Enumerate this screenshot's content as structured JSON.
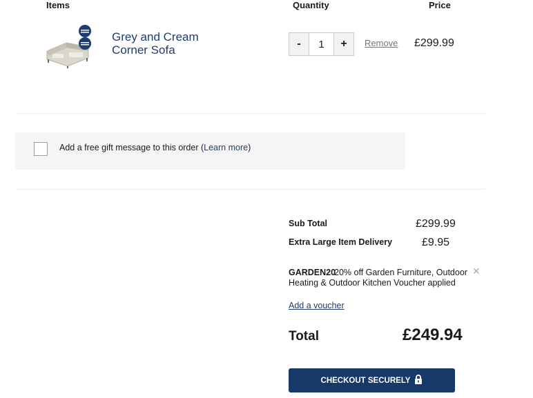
{
  "header": {
    "items": "Items",
    "quantity": "Quantity",
    "price": "Price"
  },
  "product": {
    "name": "Grey and Cream Corner Sofa",
    "quantity": "1",
    "minus": "-",
    "plus": "+",
    "remove": "Remove",
    "price": "£299.99"
  },
  "gift": {
    "text_before": "Add a free gift message to this order (",
    "link": "Learn more",
    "text_after": ")"
  },
  "summary": {
    "subtotal_label": "Sub Total",
    "subtotal_value": "£299.99",
    "delivery_label": "Extra Large Item Delivery",
    "delivery_value": "£9.95",
    "voucher_code": "GARDEN20",
    "voucher_desc": "20% off Garden Furniture, Outdoor Heating & Outdoor Kitchen Voucher applied",
    "add_voucher": "Add a voucher",
    "total_label": "Total",
    "total_value": "£249.94"
  },
  "checkout": {
    "label": "CHECKOUT SECURELY",
    "icon": "lock-icon"
  },
  "colors": {
    "brand_navy": "#17396a",
    "link": "#1f3c6e"
  }
}
